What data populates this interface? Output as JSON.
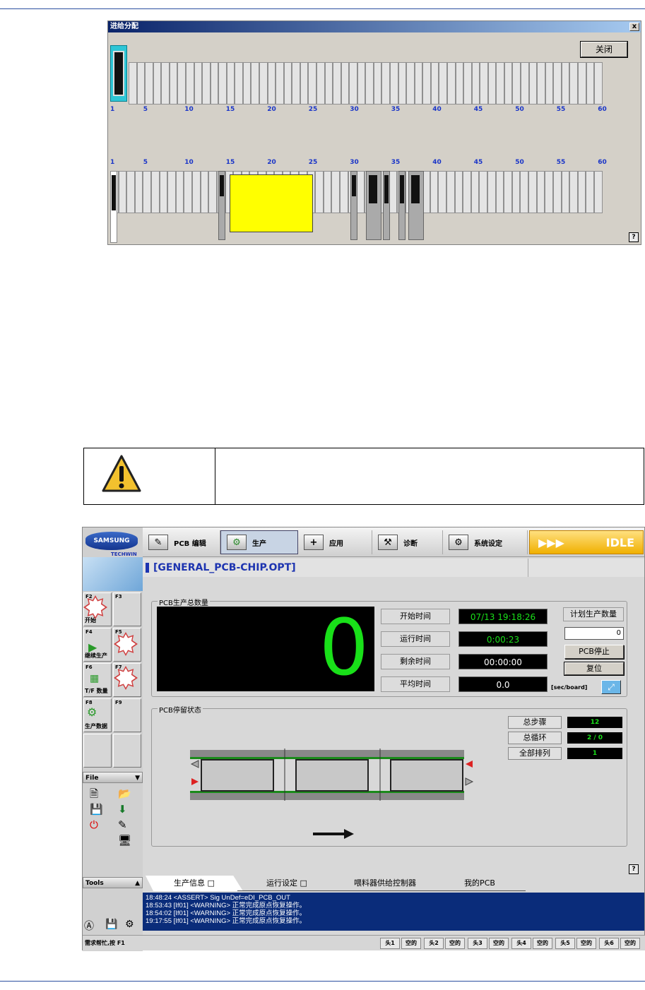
{
  "feeder_window": {
    "title": "进给分配",
    "close_x": "x",
    "close_label": "关闭",
    "numbers": [
      "1",
      "5",
      "10",
      "15",
      "20",
      "25",
      "30",
      "35",
      "40",
      "45",
      "50",
      "55",
      "60"
    ],
    "help": "?"
  },
  "ui": {
    "logo": "SAMSUNG",
    "logo_sub": "TECHWIN",
    "toolbar": [
      {
        "label": "PCB 编辑"
      },
      {
        "label": "生产"
      },
      {
        "label": "应用"
      },
      {
        "label": "诊断"
      },
      {
        "label": "系统设定"
      }
    ],
    "idle_arrows": "▶▶▶",
    "idle": "IDLE",
    "path": "[GENERAL_PCB-CHIP.OPT]",
    "fkeys": [
      {
        "tag": "F2",
        "label": "开始"
      },
      {
        "tag": "F3",
        "label": ""
      },
      {
        "tag": "F4",
        "label": "继续生产"
      },
      {
        "tag": "F5",
        "label": ""
      },
      {
        "tag": "F6",
        "label": "T/F 数量"
      },
      {
        "tag": "F7",
        "label": ""
      },
      {
        "tag": "F8",
        "label": "生产数据"
      },
      {
        "tag": "F9",
        "label": ""
      }
    ],
    "file_header": "File",
    "tools_header": "Tools",
    "pcb_total": {
      "title": "PCB生产总数量",
      "count": "0",
      "rows": [
        {
          "label": "开始时间",
          "value": "07/13 19:18:26"
        },
        {
          "label": "运行时间",
          "value": "0:00:23"
        },
        {
          "label": "剩余时间",
          "value": "00:00:00"
        },
        {
          "label": "平均时间",
          "value": "0.0"
        }
      ],
      "plan_label": "计划生产数量",
      "plan_value": "0",
      "stop_btn": "PCB停止",
      "reset_btn": "复位",
      "unit": "[sec/board]"
    },
    "pcb_stop": {
      "title": "PCB停留状态",
      "rows": [
        {
          "label": "总步骤",
          "value": "12"
        },
        {
          "label": "总循环",
          "value": "2 / 0"
        },
        {
          "label": "全部排列",
          "value": "1"
        }
      ]
    },
    "help": "?",
    "tabs": [
      "生产信息 □",
      "运行设定 □",
      "喂料器供给控制器",
      "我的PCB"
    ],
    "log": [
      "18:48:24 <ASSERT> Sig UnDef=eDI_PCB_OUT",
      "18:53:43 [If01] <WARNING> 正常完成原点恢复操作。",
      "18:54:02 [If01] <WARNING> 正常完成原点恢复操作。",
      "19:17:55 [If01] <WARNING> 正常完成原点恢复操作。"
    ],
    "status_text": "需求帮忙,按 F1",
    "heads": [
      {
        "h": "头1",
        "s": "空的"
      },
      {
        "h": "头2",
        "s": "空的"
      },
      {
        "h": "头3",
        "s": "空的"
      },
      {
        "h": "头4",
        "s": "空的"
      },
      {
        "h": "头5",
        "s": "空的"
      },
      {
        "h": "头6",
        "s": "空的"
      }
    ]
  }
}
